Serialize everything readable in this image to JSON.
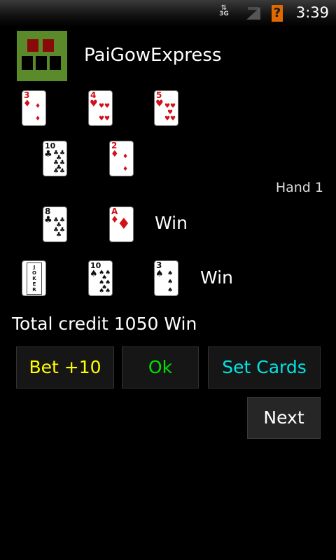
{
  "status_bar": {
    "network": "3G",
    "signal_icon": "signal-icon",
    "alert_icon": "alert-icon",
    "alert_glyph": "?",
    "time": "3:39"
  },
  "app": {
    "title": "PaiGowExpress",
    "icon_colors": {
      "background": "#5a8a2a",
      "top_blocks": "#8a0a0a",
      "bottom_blocks": "#000000"
    }
  },
  "hand_label": "Hand 1",
  "dealer_hand": {
    "row1": [
      {
        "rank": "3",
        "suit": "♦",
        "color": "red"
      },
      {
        "rank": "4",
        "suit": "♥",
        "color": "red"
      },
      {
        "rank": "5",
        "suit": "♥",
        "color": "red"
      }
    ],
    "row2": [
      {
        "rank": "10",
        "suit": "♣",
        "color": "black"
      },
      {
        "rank": "2",
        "suit": "♦",
        "color": "red"
      }
    ]
  },
  "player_hand": {
    "low": {
      "cards": [
        {
          "rank": "8",
          "suit": "♣",
          "color": "black"
        },
        {
          "rank": "A",
          "suit": "♦",
          "color": "red"
        }
      ],
      "result": "Win"
    },
    "high": {
      "cards": [
        {
          "rank": "JOKER",
          "suit": "",
          "color": "black"
        },
        {
          "rank": "10",
          "suit": "♠",
          "color": "black"
        },
        {
          "rank": "3",
          "suit": "♠",
          "color": "black"
        }
      ],
      "result": "Win"
    }
  },
  "credit": {
    "text": "Total credit 1050  Win"
  },
  "buttons": {
    "bet": "Bet +10",
    "ok": "Ok",
    "set_cards": "Set Cards",
    "next": "Next"
  },
  "colors": {
    "bet": "#ffff00",
    "ok": "#00e000",
    "set_cards": "#00e5e5"
  }
}
